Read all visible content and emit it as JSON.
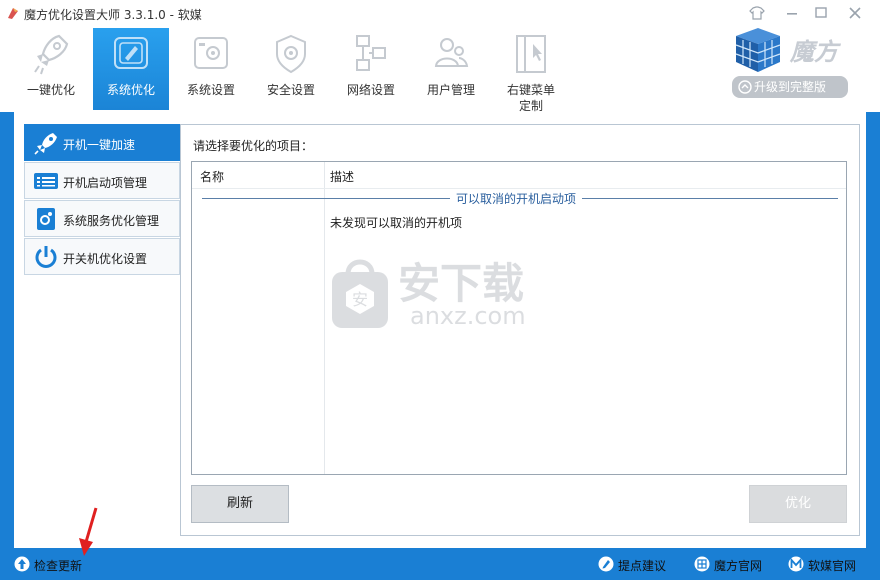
{
  "window": {
    "title": "魔方优化设置大师 3.3.1.0 - 软媒",
    "controls": [
      "shirt-icon",
      "minimize-icon",
      "maximize-icon",
      "close-icon"
    ]
  },
  "toolbar": {
    "items": [
      {
        "label": "一键优化",
        "icon": "rocket-icon"
      },
      {
        "label": "系统优化",
        "icon": "system-optimize-icon"
      },
      {
        "label": "系统设置",
        "icon": "system-settings-icon"
      },
      {
        "label": "安全设置",
        "icon": "shield-gear-icon"
      },
      {
        "label": "网络设置",
        "icon": "network-icon"
      },
      {
        "label": "用户管理",
        "icon": "users-icon"
      },
      {
        "label": "右键菜单\n定制",
        "icon": "context-menu-icon"
      }
    ]
  },
  "brand": {
    "name": "魔方",
    "upgrade_label": "升级到完整版"
  },
  "sidebar": {
    "items": [
      {
        "label": "开机一键加速",
        "icon": "rocket-icon"
      },
      {
        "label": "开机启动项管理",
        "icon": "startup-list-icon"
      },
      {
        "label": "系统服务优化管理",
        "icon": "service-gear-icon"
      },
      {
        "label": "开关机优化设置",
        "icon": "power-icon"
      }
    ]
  },
  "main": {
    "prompt": "请选择要优化的项目：",
    "columns": [
      "名称",
      "描述"
    ],
    "group_label": "可以取消的开机启动项",
    "empty_message": "未发现可以取消的开机项",
    "refresh_label": "刷新",
    "optimize_label": "优化"
  },
  "watermark": {
    "text": "安下载",
    "domain": "anxz.com"
  },
  "statusbar": {
    "check_update": "检查更新",
    "feedback": "提点建议",
    "mofang_site": "魔方官网",
    "ruanmei_site": "软媒官网"
  },
  "colors": {
    "accent": "#1a7fd4",
    "group_text": "#2a5f9e",
    "annotation_arrow": "#e02020"
  }
}
